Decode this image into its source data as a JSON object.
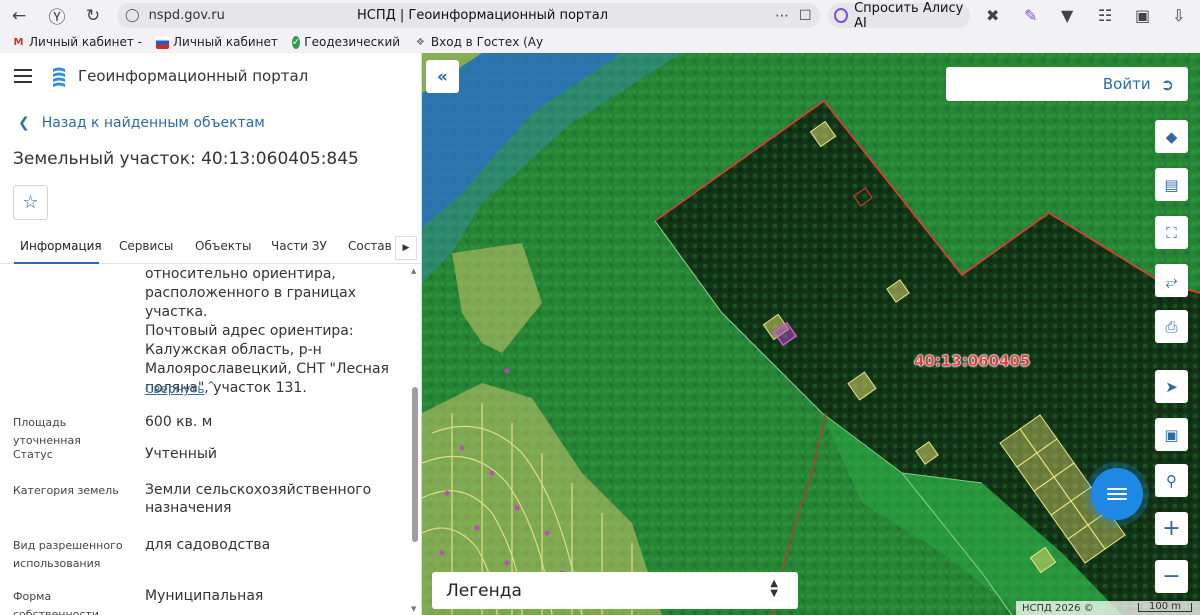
{
  "browser": {
    "url": "nspd.gov.ru",
    "page_title": "НСПД | Геоинформационный портал",
    "alice_label": "Спросить Алису AI",
    "bookmarks": [
      {
        "label": "Личный кабинет -",
        "icon": "gmail-icon"
      },
      {
        "label": "Личный кабинет",
        "icon": "flag-icon"
      },
      {
        "label": "Геодезический ка",
        "icon": "check-circle-icon"
      },
      {
        "label": "Вход в Гостех (Ау",
        "icon": "gostech-icon"
      }
    ]
  },
  "panel": {
    "portal_name": "Геоинформационный портал",
    "back_link": "Назад к найденным объектам",
    "title": "Земельный участок: 40:13:060405:845",
    "tabs": [
      "Информация",
      "Сервисы",
      "Объекты",
      "Части ЗУ",
      "Состав"
    ],
    "active_tab": "Информация",
    "address_lines": [
      "относительно ориентира,",
      "расположенного в границах участка.",
      "Почтовый адрес ориентира:",
      "Калужская область, р-н",
      "Малоярославецкий, СНТ \"Лесная",
      "поляна\", участок 131."
    ],
    "collapse_label": "Свернуть",
    "rows": [
      {
        "label": "Площадь уточненная",
        "value": "600 кв. м"
      },
      {
        "label": "Статус",
        "value": "Учтенный"
      },
      {
        "label": "Категория земель",
        "value": "Земли сельскохозяйственного назначения"
      },
      {
        "label": "Вид разрешенного использования",
        "value": "для садоводства"
      },
      {
        "label": "Форма собственности",
        "value": "Муниципальная"
      }
    ]
  },
  "map": {
    "login_label": "Войти",
    "legend_label": "Легенда",
    "cadastral_label": "40:13:060405",
    "copyright": "НСПД 2026 ©",
    "scale": "100 m",
    "tools": [
      "layers-icon",
      "ruler-icon",
      "select-area-icon",
      "share-icon",
      "print-icon",
      "locate-icon",
      "minimap-icon",
      "search-location-icon",
      "zoom-in-icon",
      "zoom-out-icon"
    ]
  }
}
